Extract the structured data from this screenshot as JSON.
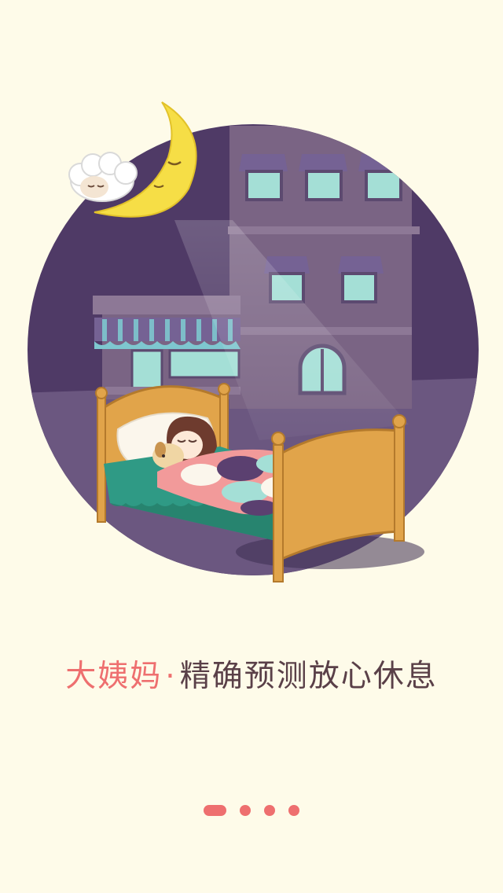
{
  "splash": {
    "brand": "大姨妈",
    "separator": "·",
    "slogan": "精确预测放心休息"
  },
  "illustration": {
    "scene": "night-sleep-illustration",
    "colors": {
      "night_sky": "#4f3a66",
      "ground": "#6b5780",
      "building": "#7a6484",
      "window_glass": "#a4dfd6",
      "awning_purple": "#756294",
      "awning_teal": "#7ec7cf",
      "moon": "#f6de46",
      "bed_wood": "#e1a44a",
      "blanket_teal": "#2f9a85",
      "quilt_pink": "#f29a9a"
    }
  },
  "pager": {
    "page_count": 4,
    "current_page": 1,
    "color": "#ee6f6f"
  }
}
